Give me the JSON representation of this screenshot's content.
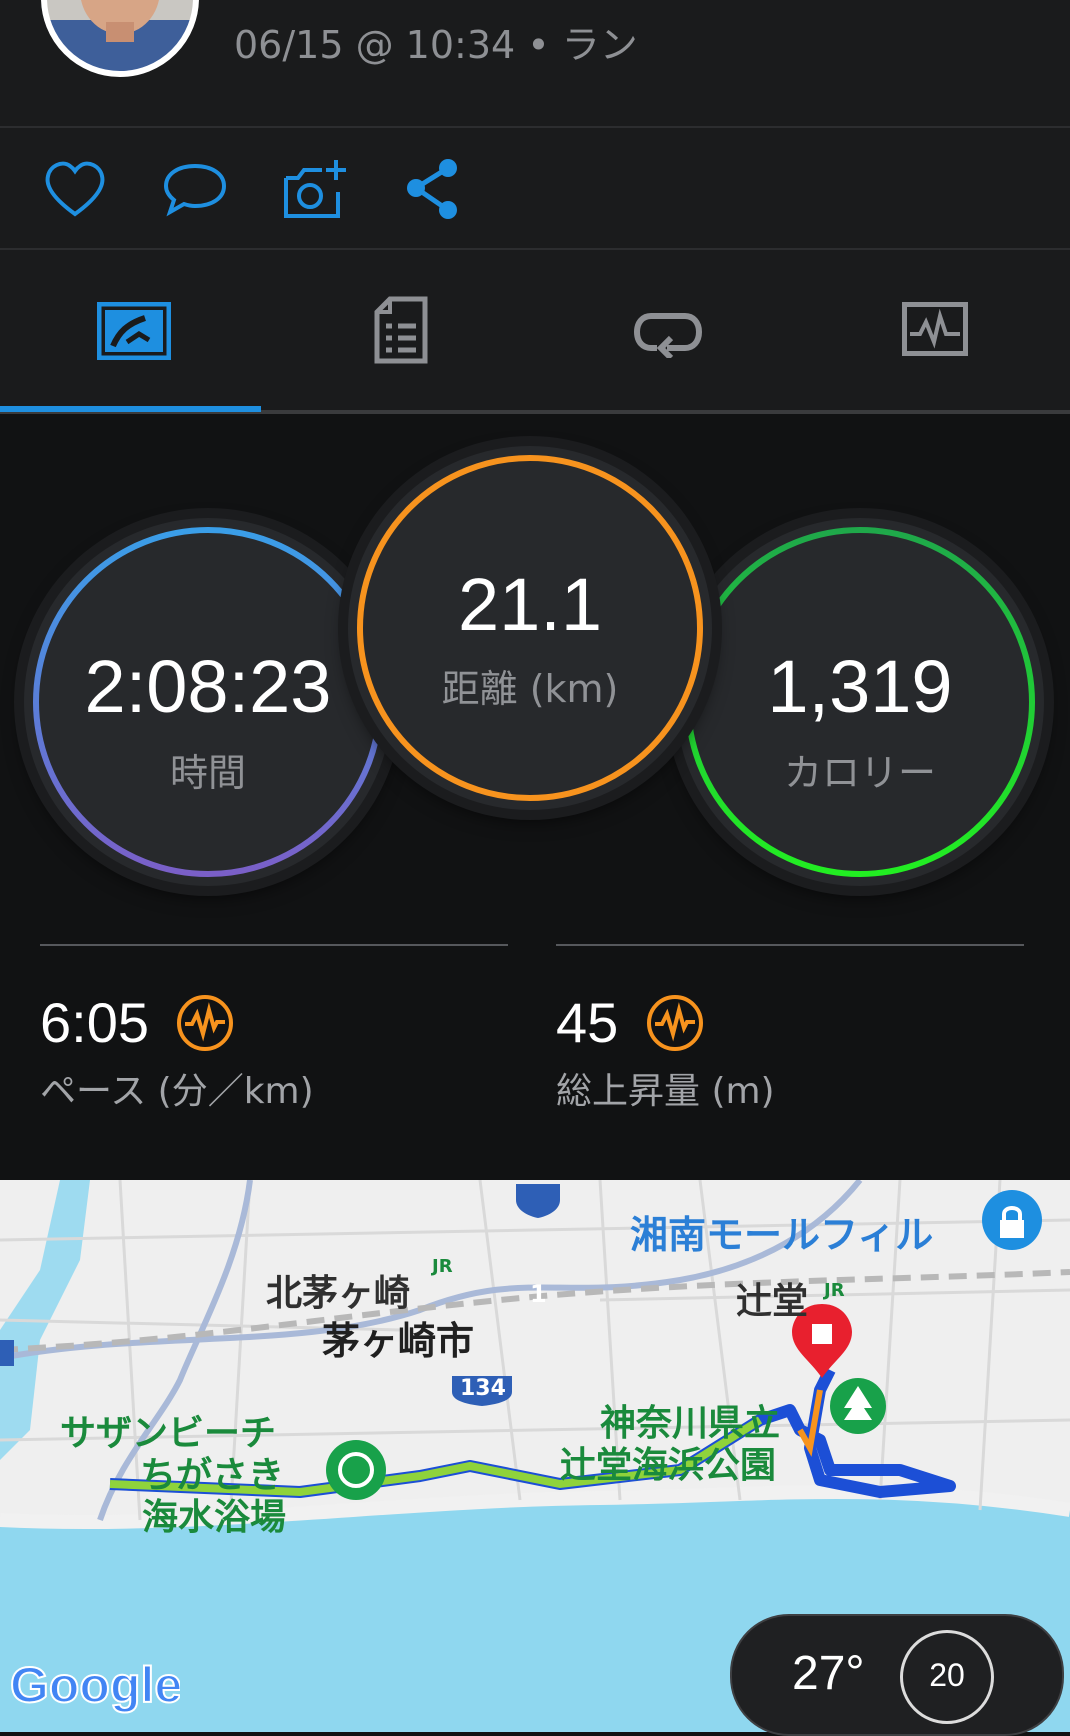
{
  "header": {
    "subtitle": "06/15 @ 10:34 • ラン"
  },
  "actions": [
    {
      "icon": "heart-icon"
    },
    {
      "icon": "comment-icon"
    },
    {
      "icon": "add-photo-icon"
    },
    {
      "icon": "share-icon"
    }
  ],
  "tabs": [
    {
      "icon": "summary-icon",
      "selected": true
    },
    {
      "icon": "details-icon",
      "selected": false
    },
    {
      "icon": "laps-icon",
      "selected": false
    },
    {
      "icon": "charts-icon",
      "selected": false
    }
  ],
  "rings": {
    "time": {
      "value": "2:08:23",
      "label": "時間"
    },
    "distance": {
      "value": "21.1",
      "label": "距離 (km)"
    },
    "calories": {
      "value": "1,319",
      "label": "カロリー"
    }
  },
  "stats": {
    "pace": {
      "value": "6:05",
      "label": "ペース (分／km)"
    },
    "elevation": {
      "value": "45",
      "label": "総上昇量 (m)"
    }
  },
  "map": {
    "labels": {
      "kitachigasaki": "北茅ヶ崎",
      "chigasaki_city": "茅ヶ崎市",
      "shonan_mall": "湘南モールフィル",
      "tsujido": "辻堂",
      "kanagawa_park_1": "神奈川県立",
      "kanagawa_park_2": "辻堂海浜公園",
      "southern_beach_1": "サザンビーチ",
      "southern_beach_2": "ちがさき",
      "southern_beach_3": "海水浴場",
      "route_1": "1",
      "route_134": "134",
      "jr": "JR"
    },
    "google": "Google"
  },
  "weather": {
    "temp": "27°",
    "wind": "20"
  },
  "colors": {
    "accent_blue": "#1e8fe0",
    "distance_ring": "#f7931e",
    "calorie_ring": "#22dd22",
    "time_ring_start": "#3a9ee8",
    "time_ring_end": "#7a5fc8"
  }
}
